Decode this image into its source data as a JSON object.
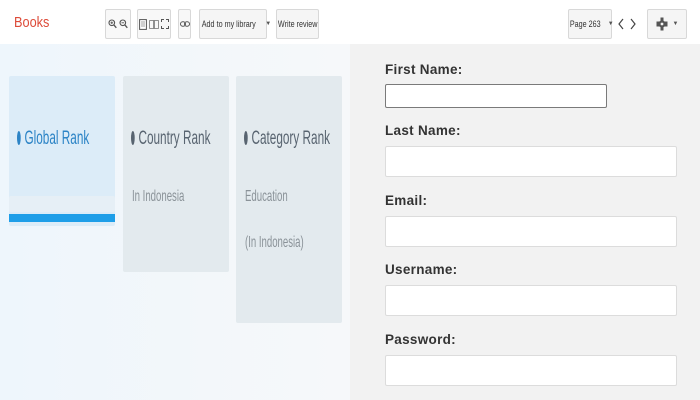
{
  "toolbar": {
    "brand": "Books",
    "add_to_library_label": "Add to my library",
    "write_review_label": "Write review",
    "page_label": "Page 263",
    "icons": [
      "zoom-in-icon",
      "zoom-out-icon",
      "single-page-icon",
      "two-page-icon",
      "fullscreen-icon",
      "link-icon",
      "chevron-left-icon",
      "chevron-right-icon",
      "gear-icon"
    ]
  },
  "ranks": {
    "global": {
      "title": "Global Rank"
    },
    "country": {
      "title": "Country Rank",
      "subtitle": "In Indonesia"
    },
    "category": {
      "title": "Category Rank",
      "subtitle": "Education",
      "subtitle2": "(In Indonesia)"
    }
  },
  "form": {
    "first_name_label": "First Name:",
    "last_name_label": "Last Name:",
    "email_label": "Email:",
    "username_label": "Username:",
    "password_label": "Password:",
    "first_name_value": "",
    "last_name_value": "",
    "email_value": "",
    "username_value": "",
    "password_value": ""
  },
  "colors": {
    "brand": "#dd4b39",
    "active_rank": "#2c84c6",
    "active_bar": "#1e9ee8",
    "form_bg": "#f2f2f2"
  }
}
